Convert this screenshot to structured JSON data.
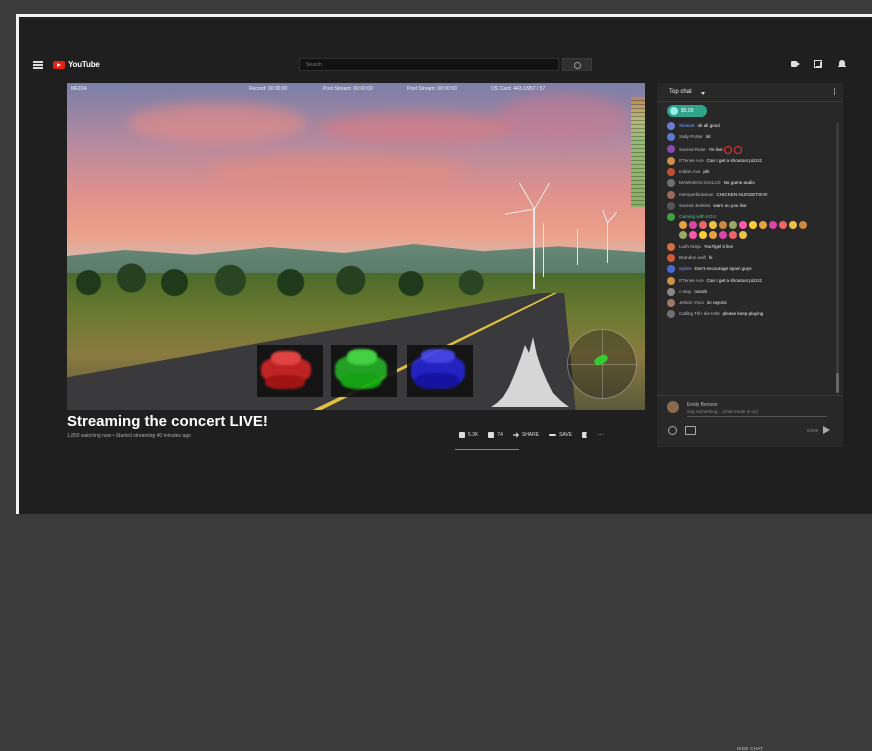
{
  "app": {
    "logo_text": "YouTube",
    "search_placeholder": "Search"
  },
  "player": {
    "stats": {
      "left_label": "MEDIA",
      "record": "Record: 00:00:00",
      "fps": "Post Stream: 00:00:00",
      "stream": "Post Stream: 00:00:00",
      "cpu": "OS Card: 443.1/957 / 57"
    }
  },
  "video": {
    "title": "Streaming the concert LIVE!",
    "meta": "1,850 watching now • Started streaming 40 minutes ago",
    "likes": "5.3K",
    "dislikes": "74",
    "share_label": "SHARE",
    "save_label": "SAVE"
  },
  "chat": {
    "header": "Top chat",
    "pinned_amount": "$5.00",
    "messages": [
      {
        "author": "Stewart",
        "text": "ok all good",
        "color": "#6b7bd0",
        "type": "mod"
      },
      {
        "author": "Sally Porter",
        "text": "lol",
        "color": "#5a7ad0",
        "type": "normal"
      },
      {
        "author": "Sacred Rose",
        "text": "I'm live",
        "color": "#8a4ab0",
        "type": "normal"
      },
      {
        "author": "It'Tense Ace",
        "text": "Can I get a shoutout pizzzz",
        "color": "#d0904a",
        "type": "normal"
      },
      {
        "author": "Indian Ave",
        "text": "pls",
        "color": "#c05030",
        "type": "normal"
      },
      {
        "author": "MAMADOU DIALLO",
        "text": "No game audio",
        "color": "#707070",
        "type": "normal"
      },
      {
        "author": "memperbintanan",
        "text": "CHICKEN NUGGETS!!!!!",
        "color": "#9a6a5a",
        "type": "normal"
      },
      {
        "author": "Sacred Jenkins",
        "text": "warn ou you live",
        "color": "#555",
        "type": "normal"
      },
      {
        "author": "Gaming with KOIJ",
        "text": "",
        "color": "#40a040",
        "type": "member"
      },
      {
        "author": "Lush Ninja",
        "text": "YouTigel it live",
        "color": "#d07040",
        "type": "normal"
      },
      {
        "author": "Brandon wolf",
        "text": "hi",
        "color": "#d05a3a",
        "type": "normal"
      },
      {
        "author": "Sykes",
        "text": "Don't encourage spam guys",
        "color": "#4a6ad0",
        "type": "mod"
      },
      {
        "author": "It'Tense Ace",
        "text": "Can I get a shoutout pizzzz",
        "color": "#d0904a",
        "type": "normal"
      },
      {
        "author": "c-stay",
        "text": "ooooh",
        "color": "#888",
        "type": "normal"
      },
      {
        "author": "Jetson Yoco",
        "text": "im rayons",
        "color": "#9a7a6a",
        "type": "normal"
      },
      {
        "author": "Calling Till I die Hrkt",
        "text": "please keep playing",
        "color": "#707070",
        "type": "normal"
      }
    ],
    "viewer_name": "Emily Benson",
    "input_placeholder": "Say something... (chat mode is on)",
    "char_counter": "0/200",
    "hide_chat": "HIDE CHAT"
  }
}
